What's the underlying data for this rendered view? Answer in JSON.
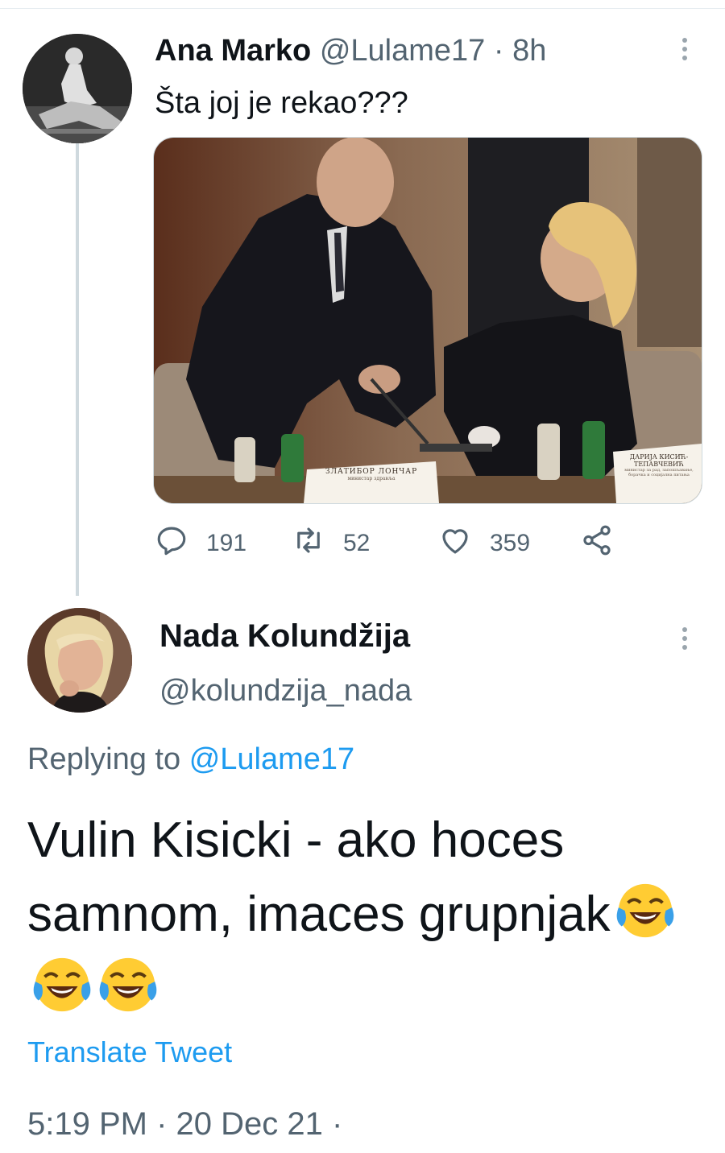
{
  "tweet1": {
    "name": "Ana Marko",
    "handle": "@Lulame17",
    "separator": "·",
    "time": "8h",
    "text": "Šta joj je rekao???",
    "photo": {
      "placard_left": [
        "ЗЛАТИБОР ЛОНЧАР",
        "министар здравља"
      ],
      "placard_right": [
        "ДАРИЈА КИСИЋ-",
        "ТЕПАВЧЕВИЋ",
        "министар за рад, запошљавање,",
        "борачка и социјална питања"
      ]
    },
    "replies": "191",
    "retweets": "52",
    "likes": "359"
  },
  "tweet2": {
    "name": "Nada Kolundžija",
    "handle": "@kolundzija_nada",
    "replying_prefix": "Replying to",
    "replying_handle": "@Lulame17",
    "text": "Vulin Kisicki - ako hoces samnom, imaces grupnjak",
    "emoji_count": 3,
    "translate": "Translate Tweet",
    "timestamp": "5:19 PM · 20 Dec 21 ·"
  },
  "colors": {
    "link": "#1d9bf0",
    "muted": "#536471",
    "text": "#0f1419",
    "thread_line": "#cfd9de"
  },
  "icons": [
    "reply-icon",
    "retweet-icon",
    "like-icon",
    "share-icon",
    "more-icon",
    "laughing-emoji-icon"
  ]
}
